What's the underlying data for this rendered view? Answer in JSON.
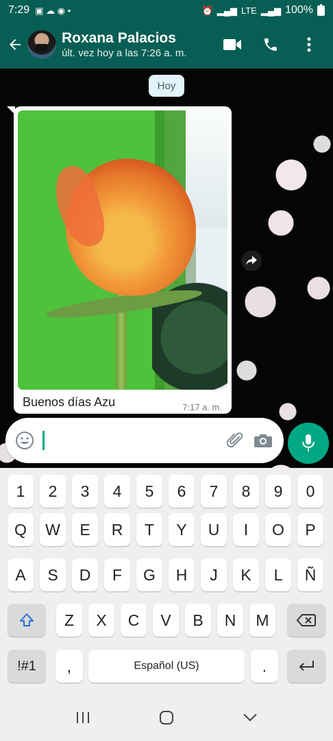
{
  "status_bar": {
    "time": "7:29",
    "battery": "100%",
    "lte": "LTE"
  },
  "header": {
    "name": "Roxana Palacios",
    "status": "últ. vez hoy a las 7:26 a. m."
  },
  "chat": {
    "date_chip": "Hoy",
    "message": {
      "caption": "Buenos días Azu",
      "time": "7:17 a. m."
    }
  },
  "input": {
    "placeholder": ""
  },
  "keyboard": {
    "row1": [
      "1",
      "2",
      "3",
      "4",
      "5",
      "6",
      "7",
      "8",
      "9",
      "0"
    ],
    "row2": [
      "Q",
      "W",
      "E",
      "R",
      "T",
      "Y",
      "U",
      "I",
      "O",
      "P"
    ],
    "row3": [
      "A",
      "S",
      "D",
      "F",
      "G",
      "H",
      "J",
      "K",
      "L",
      "Ñ"
    ],
    "row4": [
      "Z",
      "X",
      "C",
      "V",
      "B",
      "N",
      "M"
    ],
    "sym": "!#1",
    "comma": ",",
    "space": "Español (US)",
    "period": "."
  },
  "colors": {
    "header": "#075E54",
    "accent": "#00a884"
  }
}
